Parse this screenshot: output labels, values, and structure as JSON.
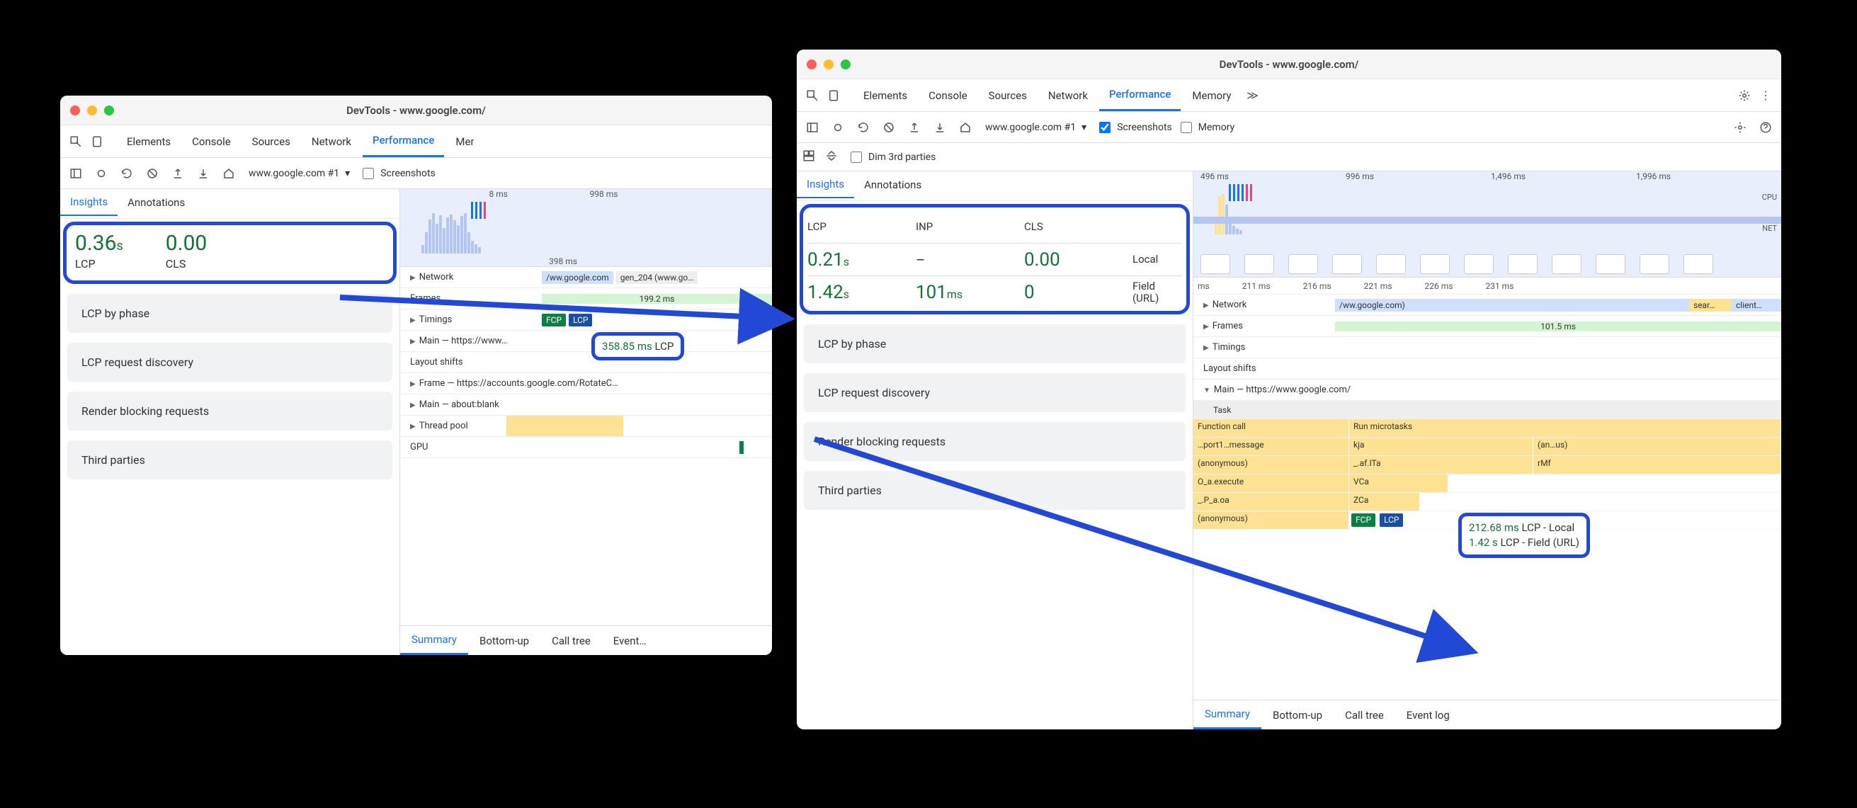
{
  "window1": {
    "title": "DevTools - www.google.com/",
    "tabs": [
      "Elements",
      "Console",
      "Sources",
      "Network",
      "Performance",
      "Memory"
    ],
    "active_tab": "Performance",
    "recording_select": "www.google.com #1",
    "checkbox_screenshots": "Screenshots",
    "subtabs": [
      "Insights",
      "Annotations"
    ],
    "active_subtab": "Insights",
    "metrics": {
      "lcp_value": "0.36",
      "lcp_unit": "s",
      "lcp_label": "LCP",
      "cls_value": "0.00",
      "cls_label": "CLS"
    },
    "insights": [
      "LCP by phase",
      "LCP request discovery",
      "Render blocking requests",
      "Third parties"
    ],
    "timeline": {
      "ticks": [
        "8 ms",
        "998 ms"
      ],
      "ruler_bottom": "398 ms"
    },
    "tracks": {
      "network": "Network",
      "network_item1": "/ww.google.com",
      "network_item2": "gen_204 (www.go…",
      "frames": "Frames",
      "frames_val": "199.2 ms",
      "timings": "Timings",
      "fcp": "FCP",
      "lcp": "LCP",
      "main": "Main — https://www…",
      "layout_shifts": "Layout shifts",
      "frame": "Frame — https://accounts.google.com/RotateC…",
      "main2": "Main — about:blank",
      "thread": "Thread pool",
      "gpu": "GPU"
    },
    "callout1": {
      "ms": "358.85 ms",
      "label": "LCP"
    },
    "bottom_tabs": [
      "Summary",
      "Bottom-up",
      "Call tree",
      "Event…"
    ],
    "bottom_active": "Summary"
  },
  "window2": {
    "title": "DevTools - www.google.com/",
    "tabs": [
      "Elements",
      "Console",
      "Sources",
      "Network",
      "Performance",
      "Memory"
    ],
    "active_tab": "Performance",
    "more": "≫",
    "recording_select": "www.google.com #1",
    "checkbox_screenshots": "Screenshots",
    "checkbox_memory": "Memory",
    "dim_label": "Dim 3rd parties",
    "subtabs": [
      "Insights",
      "Annotations"
    ],
    "active_subtab": "Insights",
    "metrics_table": {
      "head": [
        "LCP",
        "INP",
        "CLS",
        ""
      ],
      "row1": {
        "lcp": "0.21",
        "lcp_u": "s",
        "inp": "–",
        "cls": "0.00",
        "side": "Local"
      },
      "row2": {
        "lcp": "1.42",
        "lcp_u": "s",
        "inp": "101",
        "inp_u": "ms",
        "cls": "0",
        "side": "Field (URL)"
      }
    },
    "insights": [
      "LCP by phase",
      "LCP request discovery",
      "Render blocking requests",
      "Third parties"
    ],
    "timeline": {
      "ticks": [
        "496 ms",
        "996 ms",
        "1,496 ms",
        "1,996 ms"
      ],
      "cpu": "CPU",
      "net": "NET"
    },
    "ruler": [
      "ms",
      "211 ms",
      "216 ms",
      "221 ms",
      "226 ms",
      "231 ms"
    ],
    "tracks": {
      "network": "Network",
      "network_item1": "/ww.google.com)",
      "network_item2": "sear…",
      "network_item3": "client…",
      "frames": "Frames",
      "frames_val": "101.5 ms",
      "timings": "Timings",
      "layout_shifts": "Layout shifts",
      "main": "Main — https://www.google.com/",
      "task": "Task",
      "r1a": "Function call",
      "r1b": "Run microtasks",
      "r2a": "…port1…message",
      "r2b": "kja",
      "r2c": "(an…us)",
      "r3a": "(anonymous)",
      "r3b": "_.af.ITa",
      "r3c": "rMf",
      "r4a": "O_a.execute",
      "r4b": "VCa",
      "r5a": "_.P_a.oa",
      "r5b": "ZCa",
      "r6a": "(anonymous)",
      "fcp": "FCP",
      "lcp": "LCP"
    },
    "callout2": {
      "line1_ms": "212.68 ms",
      "line1_label": "LCP - Local",
      "line2_ms": "1.42 s",
      "line2_label": "LCP - Field (URL)"
    },
    "bottom_tabs": [
      "Summary",
      "Bottom-up",
      "Call tree",
      "Event log"
    ],
    "bottom_active": "Summary"
  }
}
